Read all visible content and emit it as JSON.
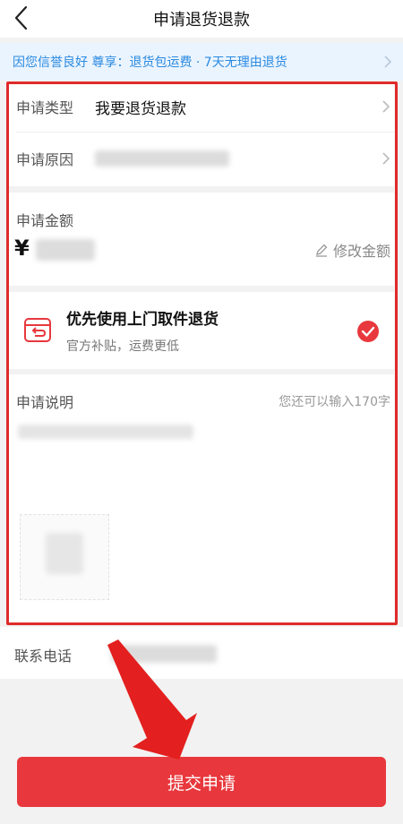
{
  "nav": {
    "title": "申请退货退款",
    "back_icon": "back-arrow-icon"
  },
  "notice": {
    "text": "因您信誉良好 尊享：退货包运费 · 7天无理由退货"
  },
  "form": {
    "type_label": "申请类型",
    "type_value": "我要退货退款",
    "reason_label": "申请原因",
    "amount_label": "申请金额",
    "amount_currency": "¥",
    "edit_amount_label": "修改金额",
    "pickup_title": "优先使用上门取件退货",
    "pickup_subtitle": "官方补贴，运费更低",
    "desc_label": "申请说明",
    "desc_remaining": "您还可以输入170字",
    "phone_label": "联系电话"
  },
  "submit": {
    "label": "提交申请"
  },
  "colors": {
    "accent": "#e8383d",
    "notice_text": "#2a8ae0",
    "annotation": "#e02a2a"
  }
}
